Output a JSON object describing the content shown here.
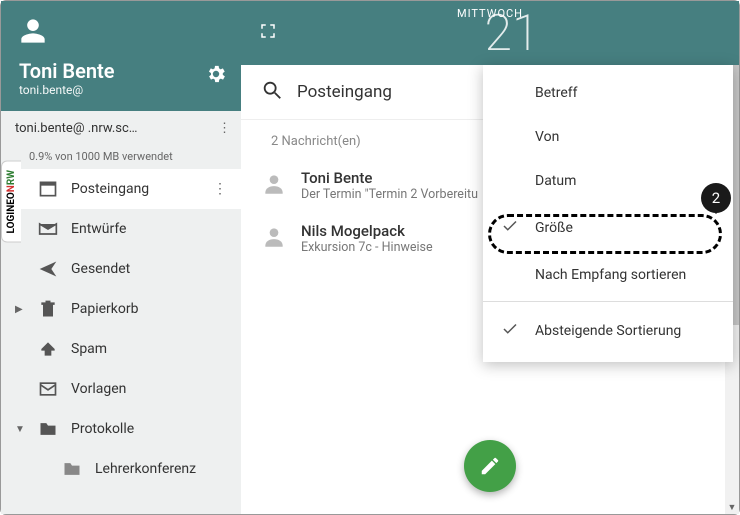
{
  "profile": {
    "name": "Toni Bente",
    "email": "toni.bente@"
  },
  "account": {
    "label": "toni.bente@        .nrw.sc…"
  },
  "storage": "0.9% von 1000 MB verwendet",
  "folders": {
    "inbox": "Posteingang",
    "drafts": "Entwürfe",
    "sent": "Gesendet",
    "trash": "Papierkorb",
    "spam": "Spam",
    "templates": "Vorlagen",
    "protocols": "Protokolle",
    "sub1": "Lehrerkonferenz"
  },
  "topbar": {
    "day": "MITTWOCH",
    "daynum": "21"
  },
  "search": {
    "title": "Posteingang"
  },
  "count": "2 Nachricht(en)",
  "messages": [
    {
      "from": "Toni Bente",
      "subject": "Der Termin \"Termin 2 Vorbereitu"
    },
    {
      "from": "Nils Mogelpack",
      "subject": "Exkursion 7c - Hinweise"
    }
  ],
  "sort": {
    "subject": "Betreff",
    "from": "Von",
    "date": "Datum",
    "size": "Größe",
    "received": "Nach Empfang sortieren",
    "desc": "Absteigende Sortierung"
  },
  "badge": "2",
  "brand": {
    "a": "LOGINEO",
    "b": "N",
    "c": "RW"
  }
}
